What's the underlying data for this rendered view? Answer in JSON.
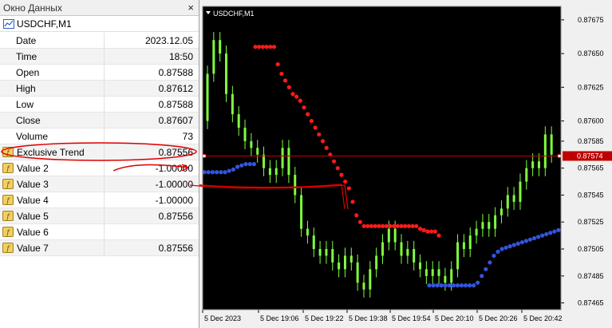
{
  "data_window": {
    "title": "Окно Данных",
    "close_label": "×",
    "symbol": "USDCHF,M1",
    "rows": [
      {
        "label": "Date",
        "value": "2023.12.05"
      },
      {
        "label": "Time",
        "value": "18:50"
      },
      {
        "label": "Open",
        "value": "0.87588"
      },
      {
        "label": "High",
        "value": "0.87612"
      },
      {
        "label": "Low",
        "value": "0.87588"
      },
      {
        "label": "Close",
        "value": "0.87607"
      },
      {
        "label": "Volume",
        "value": "73"
      }
    ],
    "indicator_rows": [
      {
        "label": "Exclusive Trend",
        "value": "0.87556"
      },
      {
        "label": "Value 2",
        "value": "-1.00000"
      },
      {
        "label": "Value 3",
        "value": "-1.00000"
      },
      {
        "label": "Value 4",
        "value": "-1.00000"
      },
      {
        "label": "Value 5",
        "value": "0.87556"
      },
      {
        "label": "Value 6",
        "value": ""
      },
      {
        "label": "Value 7",
        "value": "0.87556"
      }
    ]
  },
  "chart": {
    "title": "USDCHF,M1",
    "price_labels": [
      "0.87675",
      "0.87650",
      "0.87625",
      "0.87600",
      "0.87585",
      "0.87565",
      "0.87545",
      "0.87525",
      "0.87505",
      "0.87485",
      "0.87465"
    ],
    "current_price_label": "0.87574",
    "time_labels": [
      "5 Dec 2023",
      "5 Dec 19:06",
      "5 Dec 19:22",
      "5 Dec 19:38",
      "5 Dec 19:54",
      "5 Dec 20:10",
      "5 Dec 20:26",
      "5 Dec 20:42"
    ],
    "colors": {
      "background": "#000000",
      "candle": "#7fff3f",
      "red_dots": "#ff1a1a",
      "blue_dots": "#3355dd",
      "current_line": "#c00000",
      "annotation": "#e00000"
    }
  },
  "chart_data": {
    "type": "candlestick",
    "title": "USDCHF,M1",
    "ylim": [
      0.8746,
      0.87685
    ],
    "ticks_y": [
      0.87675,
      0.8765,
      0.87625,
      0.876,
      0.87585,
      0.87565,
      0.87545,
      0.87525,
      0.87505,
      0.87485,
      0.87465
    ],
    "current_price": 0.87574,
    "close_path": [
      0.876,
      0.87635,
      0.8766,
      0.8765,
      0.8762,
      0.87605,
      0.87595,
      0.87585,
      0.8758,
      0.87575,
      0.87565,
      0.8756,
      0.87565,
      0.8758,
      0.8756,
      0.87545,
      0.8752,
      0.87515,
      0.87505,
      0.875,
      0.87505,
      0.87495,
      0.8749,
      0.875,
      0.87495,
      0.8748,
      0.87475,
      0.8749,
      0.875,
      0.8751,
      0.8752,
      0.8751,
      0.875,
      0.87505,
      0.87495,
      0.8749,
      0.87485,
      0.8749,
      0.87485,
      0.8748,
      0.8749,
      0.8751,
      0.87505,
      0.87515,
      0.8752,
      0.87525,
      0.8752,
      0.8753,
      0.87535,
      0.87545,
      0.8754,
      0.87555,
      0.87565,
      0.8757,
      0.87565,
      0.8759,
      0.87575
    ],
    "red_dots": [
      0.87655,
      0.87655,
      0.87655,
      0.87655,
      0.87655,
      0.87655,
      0.87642,
      0.87635,
      0.8763,
      0.87625,
      0.8762,
      0.87618,
      0.87615,
      0.8761,
      0.87605,
      0.876,
      0.87595,
      0.8759,
      0.87585,
      0.8758,
      0.87575,
      0.8757,
      0.87565,
      0.8756,
      0.87555,
      0.8755,
      0.8754,
      0.8753,
      0.87525,
      0.87522,
      0.87522,
      0.87522,
      0.87522,
      0.87522,
      0.87522,
      0.87522,
      0.87522,
      0.87522,
      0.87522,
      0.87522,
      0.87522,
      0.87522,
      0.87522,
      0.87522,
      0.8752,
      0.87519,
      0.87518,
      0.87518,
      0.87518,
      0.87515
    ],
    "blue_dots": [
      0.87562,
      0.87562,
      0.87562,
      0.87562,
      0.87562,
      0.87562,
      0.87563,
      0.87564,
      0.87566,
      0.87567,
      0.87568,
      0.87568,
      0.87568,
      0.87478,
      0.87478,
      0.87478,
      0.87478,
      0.87478,
      0.87478,
      0.87478,
      0.87478,
      0.87478,
      0.87478,
      0.87478,
      0.87478,
      0.8748,
      0.87485,
      0.8749,
      0.87495,
      0.875,
      0.87503,
      0.87505,
      0.87506,
      0.87507,
      0.87508,
      0.87509,
      0.8751,
      0.87511,
      0.87512,
      0.87513,
      0.87514,
      0.87515,
      0.87516,
      0.87517,
      0.87518,
      0.87519,
      0.8752
    ]
  }
}
